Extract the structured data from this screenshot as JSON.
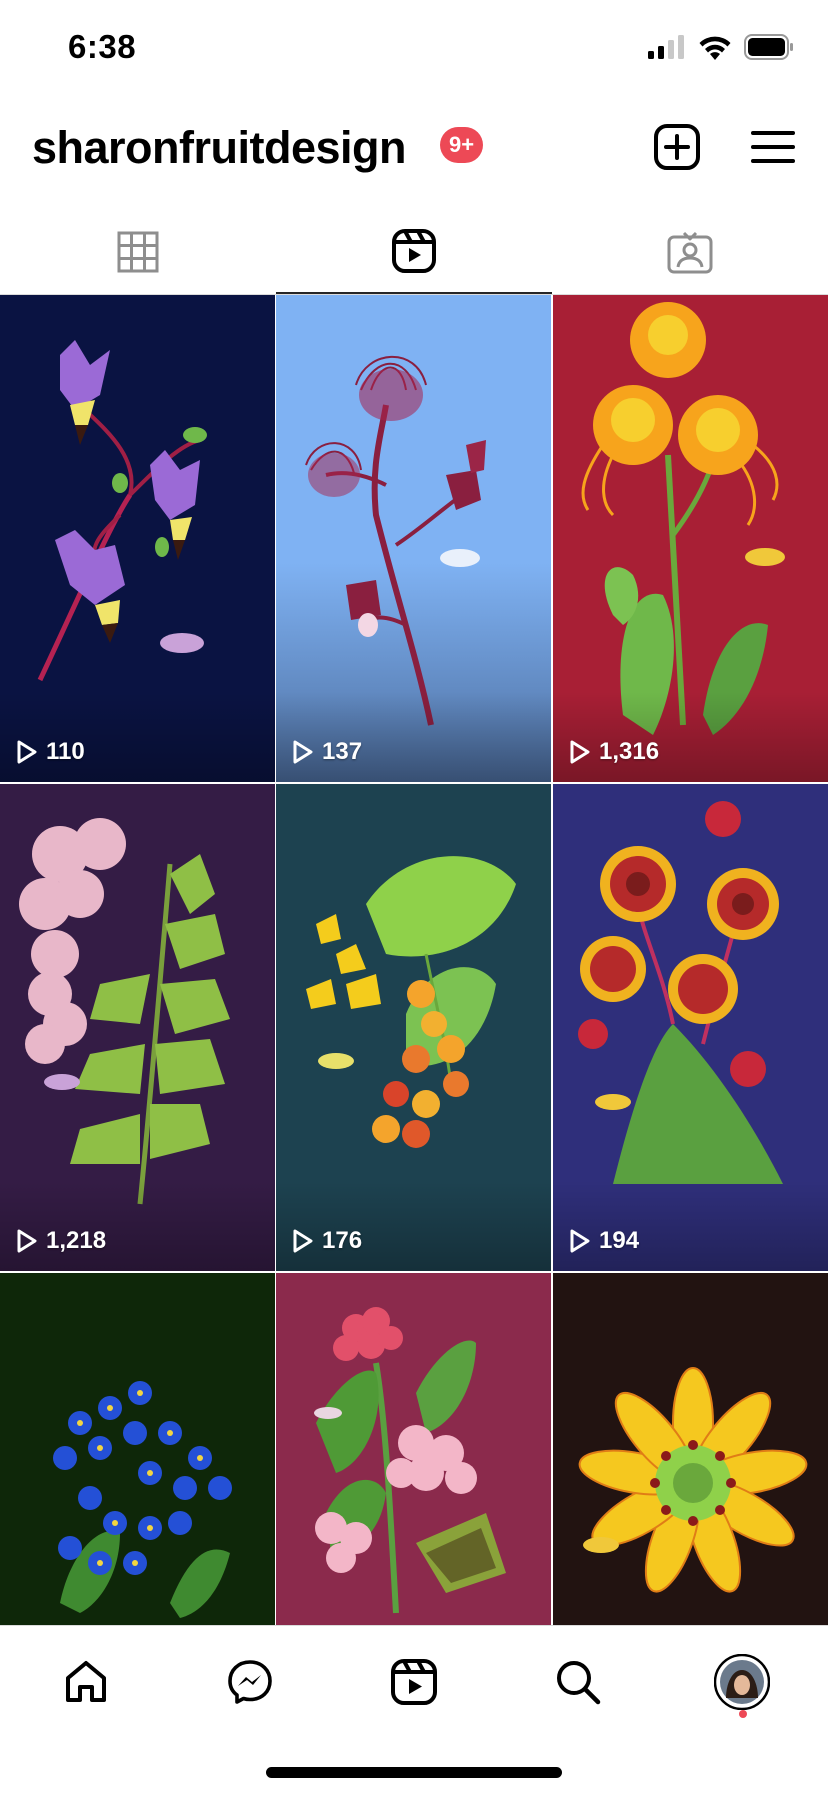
{
  "status_bar": {
    "time": "6:38"
  },
  "header": {
    "username": "sharonfruitdesign",
    "notification_badge": "9+"
  },
  "tabs": [
    {
      "name": "posts-grid",
      "icon": "grid-icon"
    },
    {
      "name": "reels",
      "icon": "reels-icon",
      "active": true
    },
    {
      "name": "tagged",
      "icon": "tagged-icon"
    }
  ],
  "reels": [
    {
      "views": "110",
      "bg": "#0a1342"
    },
    {
      "views": "137",
      "bg": "#7fb2f3"
    },
    {
      "views": "1,316",
      "bg": "#a81f35"
    },
    {
      "views": "1,218",
      "bg": "#341c45"
    },
    {
      "views": "176",
      "bg": "#1d4250"
    },
    {
      "views": "194",
      "bg": "#2f2f7b"
    },
    {
      "views": "",
      "bg": "#0e2709"
    },
    {
      "views": "",
      "bg": "#8b2a4c"
    },
    {
      "views": "",
      "bg": "#221311"
    }
  ],
  "bottom_nav": [
    "home-icon",
    "messenger-icon",
    "reels-icon",
    "search-icon",
    "profile-avatar"
  ],
  "colors": {
    "badge": "#ed4956",
    "text": "#000000"
  }
}
